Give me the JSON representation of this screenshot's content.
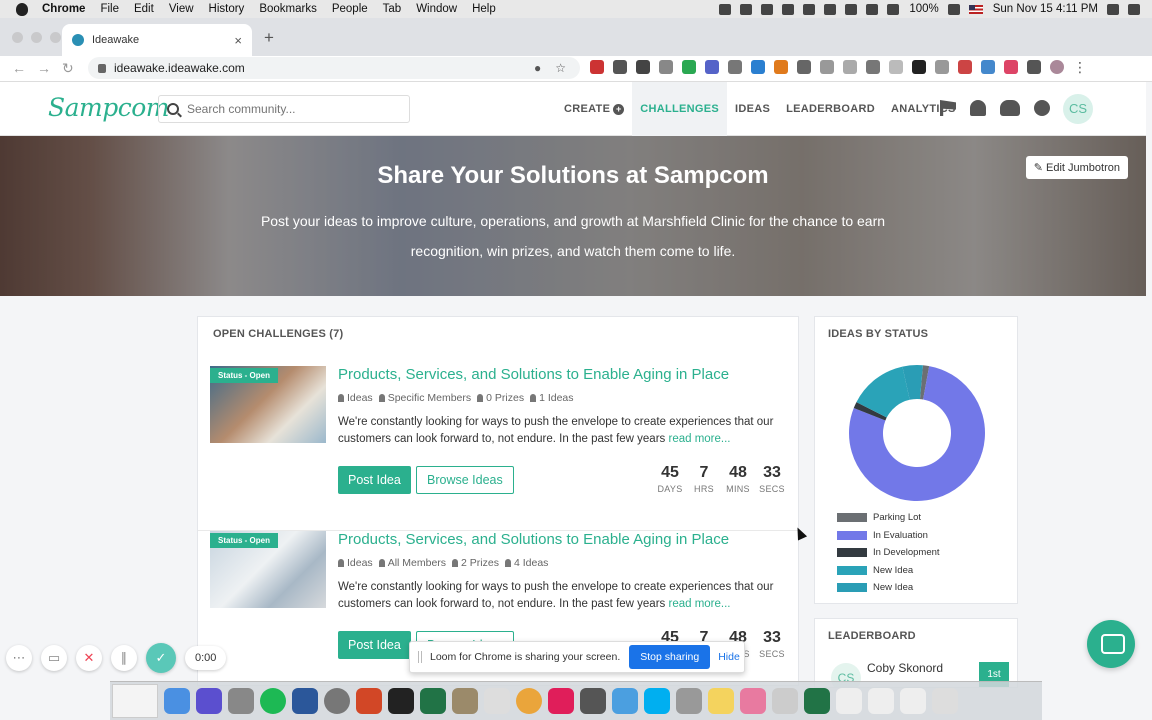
{
  "mac": {
    "menu": [
      "Chrome",
      "File",
      "Edit",
      "View",
      "History",
      "Bookmarks",
      "People",
      "Tab",
      "Window",
      "Help"
    ],
    "battery": "100%",
    "datetime": "Sun Nov 15  4:11 PM"
  },
  "browser": {
    "tab_title": "Ideawake",
    "tab_close": "×",
    "new_tab": "+",
    "url": "ideawake.ideawake.com"
  },
  "header": {
    "logo": "Sampcom",
    "search_placeholder": "Search community...",
    "nav": {
      "create": "CREATE",
      "challenges": "CHALLENGES",
      "ideas": "IDEAS",
      "leaderboard": "LEADERBOARD",
      "analytics": "ANALYTICS"
    },
    "avatar_initials": "CS"
  },
  "hero": {
    "title": "Share Your Solutions at Sampcom",
    "subtitle": "Post your ideas to improve culture, operations, and growth at Marshfield Clinic for the chance to earn recognition, win prizes, and watch them come to life.",
    "edit_button": "Edit Jumbotron"
  },
  "challenges": {
    "heading": "OPEN CHALLENGES (7)",
    "items": [
      {
        "badge": "Status - Open",
        "title": "Products, Services, and Solutions to Enable Aging in Place",
        "meta_type": "Ideas",
        "meta_audience": "Specific Members",
        "meta_prizes": "0 Prizes",
        "meta_ideas": "1 Ideas",
        "description": "We're constantly looking for ways to push the envelope to create experiences that our customers can look forward to, not endure. In the past few years",
        "read_more": "read more...",
        "post_label": "Post Idea",
        "browse_label": "Browse Ideas",
        "countdown": {
          "days": "45",
          "hrs": "7",
          "mins": "48",
          "secs": "33"
        }
      },
      {
        "badge": "Status - Open",
        "title": "Products, Services, and Solutions to Enable Aging in Place",
        "meta_type": "Ideas",
        "meta_audience": "All Members",
        "meta_prizes": "2 Prizes",
        "meta_ideas": "4 Ideas",
        "description": "We're constantly looking for ways to push the envelope to create experiences that our customers can look forward to, not endure. In the past few years",
        "read_more": "read more...",
        "post_label": "Post Idea",
        "browse_label": "Browse Ideas",
        "countdown": {
          "days": "45",
          "hrs": "7",
          "mins": "48",
          "secs": "33"
        }
      }
    ],
    "countdown_labels": {
      "days": "DAYS",
      "hrs": "HRS",
      "mins": "MINS",
      "secs": "SECS"
    }
  },
  "status_card": {
    "heading": "IDEAS BY STATUS",
    "legend": [
      "Parking Lot",
      "In Evaluation",
      "In Development",
      "New Idea",
      "New Idea"
    ],
    "colors": [
      "#6b6f73",
      "#7278e8",
      "#333a40",
      "#2aa3b8",
      "#2a9db5"
    ],
    "slices": [
      0.015,
      0.78,
      0.015,
      0.14,
      0.05
    ]
  },
  "leaderboard": {
    "heading": "LEADERBOARD",
    "avatar": "CS",
    "name": "Coby Skonord",
    "rank": "1st"
  },
  "loom": {
    "timer": "0:00",
    "share_text": "Loom for Chrome is sharing your screen.",
    "stop_label": "Stop sharing",
    "hide_label": "Hide"
  }
}
